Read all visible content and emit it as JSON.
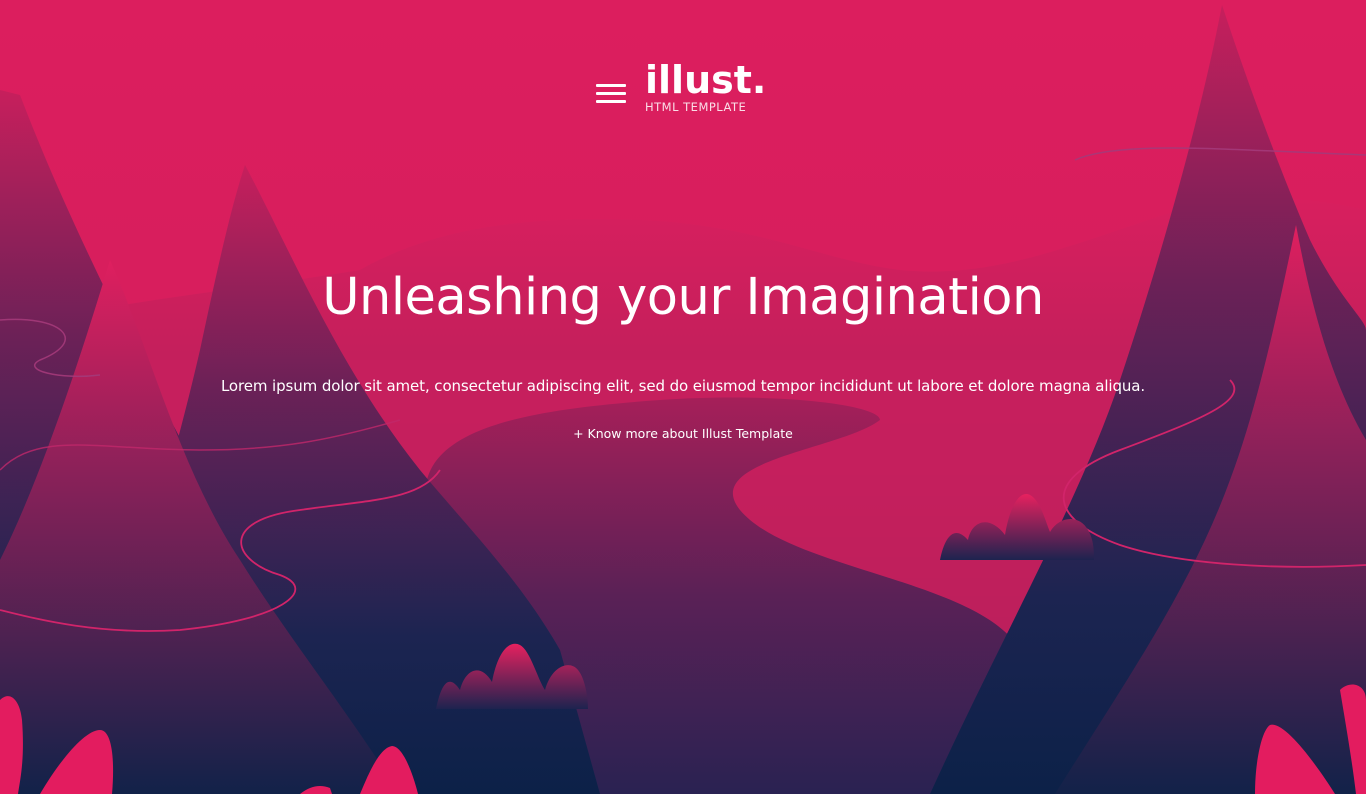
{
  "logo": {
    "title": "illust.",
    "subtitle": "HTML TEMPLATE"
  },
  "nav": {
    "menu_icon": "hamburger-menu-icon"
  },
  "hero": {
    "title": "Unleashing your Imagination",
    "text": "Lorem ipsum dolor sit amet, consectetur adipiscing elit, sed do eiusmod tempor incididunt ut labore et dolore magna aliqua.",
    "link": "+ Know more about Illust Template"
  },
  "colors": {
    "sky": "#d91d5d",
    "navy": "#0f2148",
    "pink": "#e31c5f",
    "text": "#ffffff"
  }
}
